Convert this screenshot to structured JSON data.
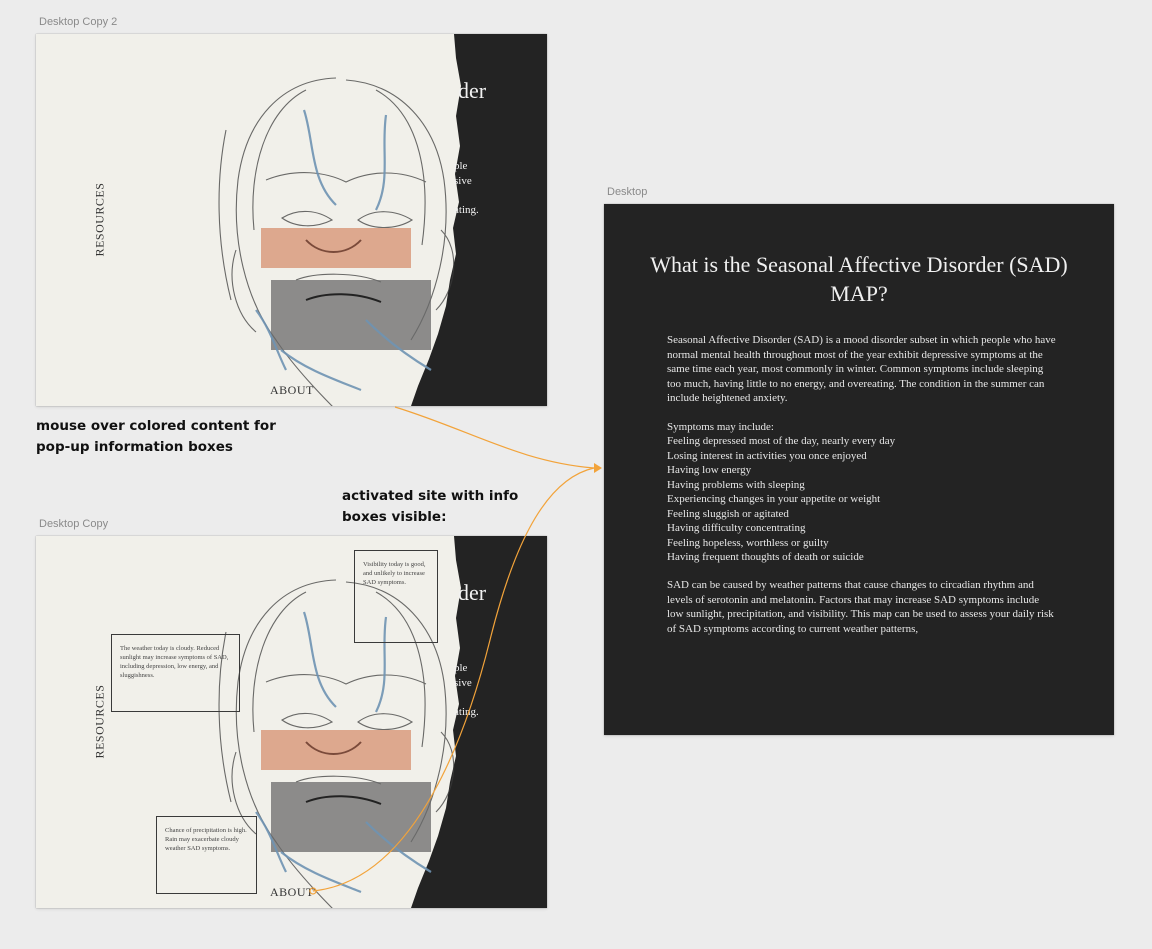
{
  "frames": {
    "top": {
      "label": "Desktop Copy 2",
      "vertical_label": "RESOURCES",
      "bottom_label": "ABOUT",
      "title_fragment": "der",
      "fragment_lines": [
        "ple",
        "sive",
        "ating."
      ]
    },
    "bottom": {
      "label": "Desktop Copy",
      "vertical_label": "RESOURCES",
      "bottom_label": "ABOUT",
      "title_fragment": "der",
      "fragment_lines": [
        "ple",
        "sive",
        "ating."
      ],
      "info_boxes": [
        {
          "text": "Visibility today is good, and unlikely to increase SAD symptoms."
        },
        {
          "text": "The weather today is cloudy. Reduced sunlight may increase symptoms of SAD, including depression, low energy, and sluggishness."
        },
        {
          "text": "Chance of precipitation is high. Rain may exacerbate cloudy weather SAD symptoms."
        }
      ]
    },
    "right": {
      "label": "Desktop",
      "title": "What is the Seasonal Affective Disorder (SAD) MAP?",
      "intro": "Seasonal Affective Disorder (SAD) is a mood disorder subset in which people who have normal mental health throughout most of the year exhibit depressive symptoms at the same time each year, most commonly in winter. Common symptoms include sleeping too much, having little to no energy, and overeating. The condition in the summer can include heightened anxiety.",
      "symptoms_heading": "Symptoms may include:",
      "symptoms": [
        "Feeling depressed most of the day, nearly every day",
        "Losing interest in activities you once enjoyed",
        "Having low energy",
        "Having problems with sleeping",
        "Experiencing changes in your appetite or weight",
        "Feeling sluggish or agitated",
        "Having difficulty concentrating",
        "Feeling hopeless, worthless or guilty",
        "Having frequent thoughts of death or suicide"
      ],
      "closing": "SAD can be caused by weather patterns that cause changes to circadian rhythm and levels of serotonin and melatonin. Factors that may increase SAD symptoms include low sunlight, precipitation, and visibility. This map can be used to assess your daily risk of SAD symptoms according to current weather patterns,"
    }
  },
  "annotations": {
    "hover_note_line1": "mouse over colored content for",
    "hover_note_line2": "pop-up information boxes",
    "activated_note_line1": "activated site with info",
    "activated_note_line2": "boxes visible:"
  },
  "colors": {
    "canvas": "#ececec",
    "paper": "#f1f0ea",
    "dark": "#232323",
    "connector": "#f2a33a",
    "sketch_blue": "#6f93b3"
  }
}
